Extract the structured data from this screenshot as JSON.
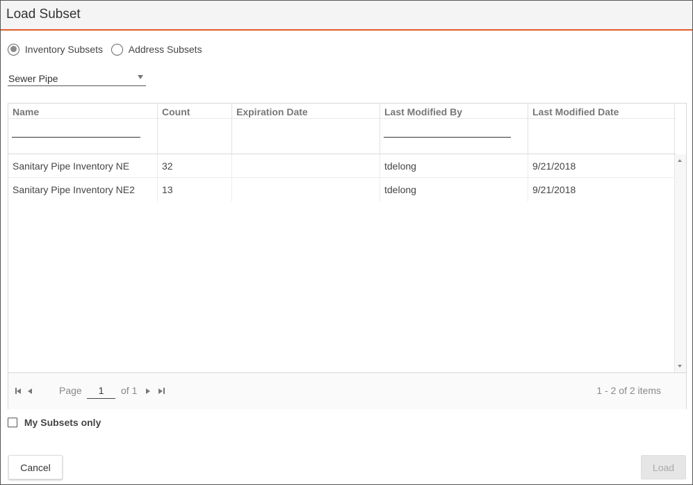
{
  "dialog": {
    "title": "Load Subset"
  },
  "subset_type": {
    "options": [
      {
        "label": "Inventory Subsets",
        "checked": true
      },
      {
        "label": "Address Subsets",
        "checked": false
      }
    ]
  },
  "layer_select": {
    "value": "Sewer Pipe"
  },
  "grid": {
    "columns": [
      "Name",
      "Count",
      "Expiration Date",
      "Last Modified By",
      "Last Modified Date"
    ],
    "rows": [
      [
        "Sanitary Pipe Inventory NE",
        "32",
        "",
        "tdelong",
        "9/21/2018"
      ],
      [
        "Sanitary Pipe Inventory NE2",
        "13",
        "",
        "tdelong",
        "9/21/2018"
      ]
    ]
  },
  "pager": {
    "page_label": "Page",
    "current_page": "1",
    "of_label": "of 1",
    "items_info": "1 - 2 of 2 items"
  },
  "my_subsets": {
    "label": "My Subsets only",
    "checked": false
  },
  "buttons": {
    "cancel": "Cancel",
    "load": "Load"
  },
  "colors": {
    "accent": "#e05a26"
  }
}
